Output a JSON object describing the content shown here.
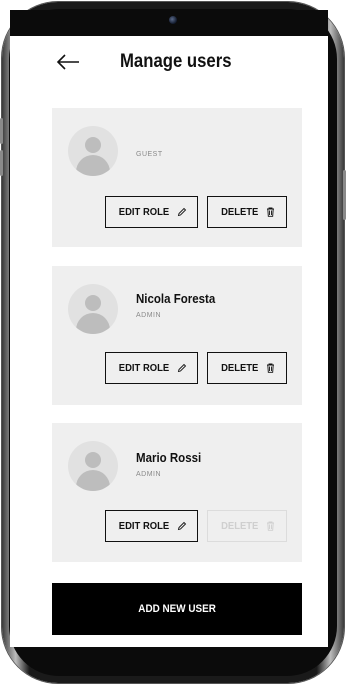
{
  "header": {
    "title": "Manage users",
    "back_icon": "arrow-left-icon"
  },
  "users": [
    {
      "name": "",
      "role": "GUEST",
      "edit_label": "EDIT ROLE",
      "delete_label": "DELETE",
      "delete_enabled": true
    },
    {
      "name": "Nicola Foresta",
      "role": "ADMIN",
      "edit_label": "EDIT ROLE",
      "delete_label": "DELETE",
      "delete_enabled": true
    },
    {
      "name": "Mario Rossi",
      "role": "ADMIN",
      "edit_label": "EDIT ROLE",
      "delete_label": "DELETE",
      "delete_enabled": false
    }
  ],
  "footer": {
    "add_label": "ADD NEW USER"
  },
  "icons": {
    "edit": "pencil-icon",
    "delete": "trash-icon",
    "avatar": "user-avatar-icon"
  },
  "colors": {
    "card_bg": "#efefef",
    "primary": "#000000",
    "disabled": "#cfcfcf"
  }
}
